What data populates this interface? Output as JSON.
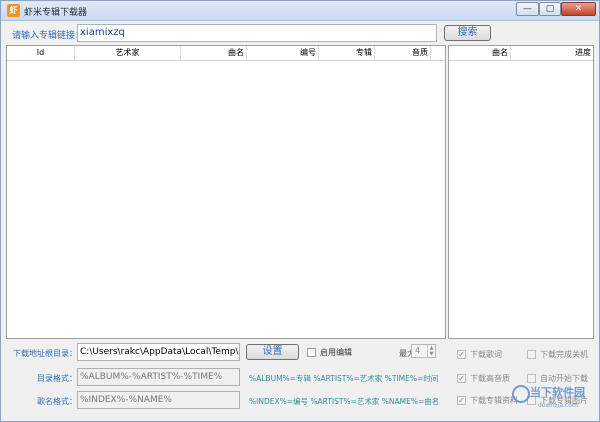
{
  "window": {
    "title": "虾米专辑下载器",
    "icon_glyph": "虾",
    "controls": {
      "minimize": "—",
      "maximize": "▢",
      "close": "✕"
    }
  },
  "url_bar": {
    "label": "请输入专辑链接：",
    "value": "xiamixzq",
    "search_label": "搜索"
  },
  "main_table": {
    "columns": [
      "Id",
      "艺术家",
      "曲名",
      "编号",
      "专辑",
      "音质"
    ],
    "rows": []
  },
  "side_table": {
    "columns": [
      "曲名",
      "进度"
    ],
    "rows": []
  },
  "download": {
    "root_label": "下载地址根目录：",
    "root_value": "C:\\Users\\rakc\\AppData\\Local\\Temp\\",
    "settings_label": "设置",
    "enable_edit_label": "启用编辑",
    "enable_edit_checked": false,
    "max_label": "最大",
    "max_value": "4"
  },
  "dir_format": {
    "label": "目录格式：",
    "value": "%ALBUM%-%ARTIST%-%TIME%",
    "hint": "%ALBUM%=专辑 %ARTIST%=艺术家 %TIME%=时间"
  },
  "song_format": {
    "label": "歌名格式：",
    "value": "%INDEX%-%NAME%",
    "hint": "%INDEX%=编号 %ARTIST%=艺术家 %NAME%=曲名"
  },
  "options": {
    "lyrics": {
      "label": "下载歌词",
      "checked": true
    },
    "shutdown": {
      "label": "下载完成关机",
      "checked": false
    },
    "hq": {
      "label": "下载高音质",
      "checked": true
    },
    "autostart": {
      "label": "自动开始下载",
      "checked": false
    },
    "album_info": {
      "label": "下载专辑资料",
      "checked": true
    },
    "album_cover": {
      "label": "下载专辑图片",
      "checked": false
    }
  },
  "watermark": {
    "title": "当下软件园",
    "subtitle": "downxia.com"
  },
  "colors": {
    "label_blue": "#2a6fb8",
    "hint_teal": "#2c8f9e",
    "titlebar": "#c9daef",
    "close_red": "#c4432c"
  }
}
